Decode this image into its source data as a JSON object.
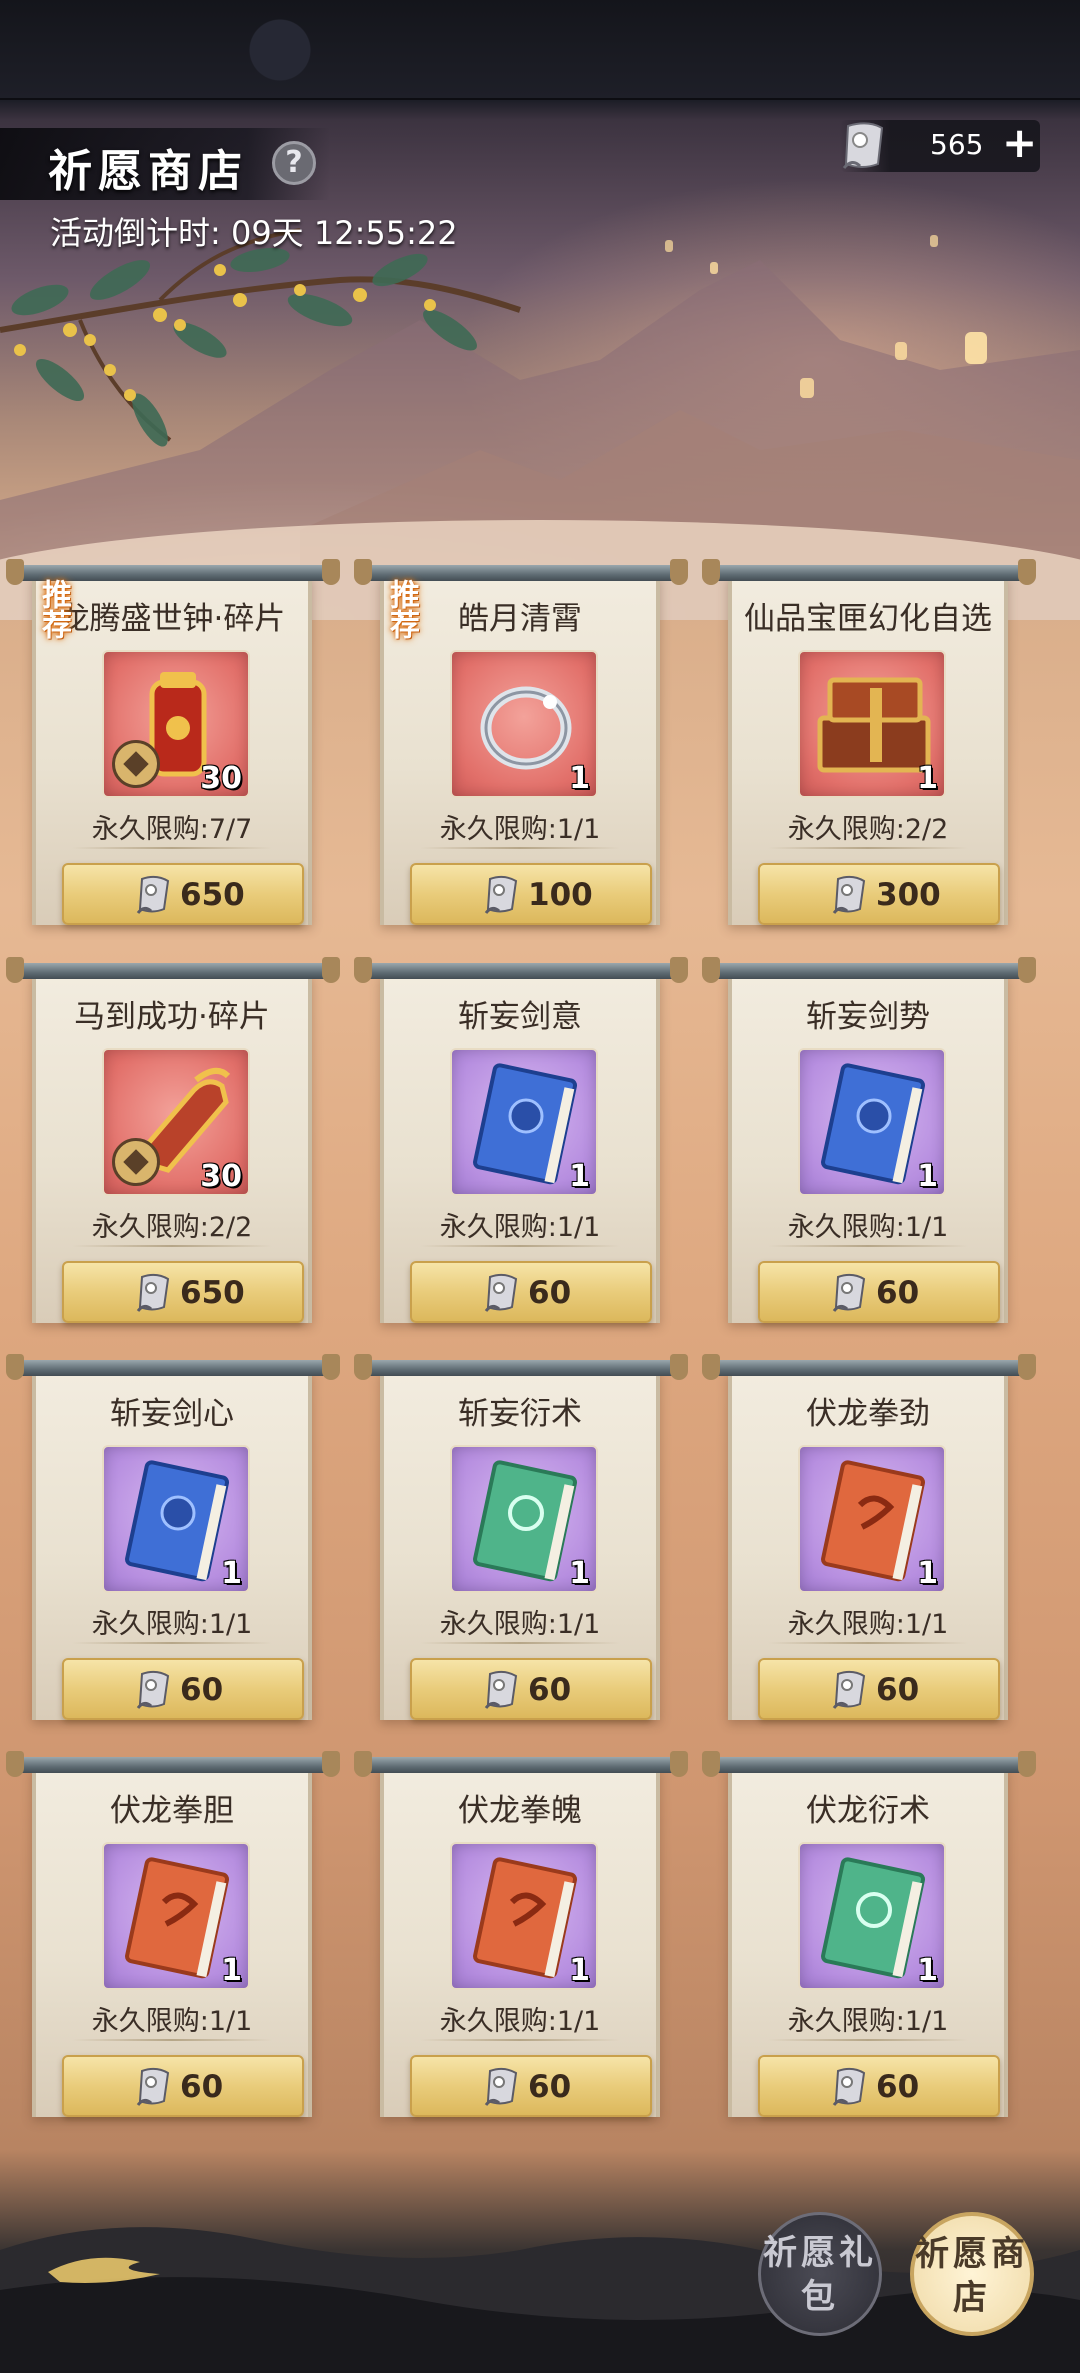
{
  "header": {
    "title": "祈愿商店",
    "help_label": "?",
    "countdown": "活动倒计时: 09天 12:55:22",
    "currency_value": "565",
    "currency_plus": "+"
  },
  "items": [
    {
      "name": "龙腾盛世钟·碎片",
      "rec": "推荐",
      "frame": "red",
      "icon": "bell-fragment-icon",
      "qty": "30",
      "fragment": true,
      "limit": "永久限购:7/7",
      "price": "650"
    },
    {
      "name": "皓月清霄",
      "rec": "推荐",
      "frame": "red",
      "icon": "silver-ring-icon",
      "qty": "1",
      "fragment": false,
      "limit": "永久限购:1/1",
      "price": "100"
    },
    {
      "name": "仙品宝匣幻化自选",
      "rec": "",
      "frame": "red",
      "icon": "treasure-box-icon",
      "qty": "1",
      "fragment": false,
      "limit": "永久限购:2/2",
      "price": "300"
    },
    {
      "name": "马到成功·碎片",
      "rec": "",
      "frame": "red",
      "icon": "horse-fragment-icon",
      "qty": "30",
      "fragment": true,
      "limit": "永久限购:2/2",
      "price": "650"
    },
    {
      "name": "斩妄剑意",
      "rec": "",
      "frame": "purple",
      "icon": "blue-book-icon",
      "qty": "1",
      "fragment": false,
      "limit": "永久限购:1/1",
      "price": "60"
    },
    {
      "name": "斩妄剑势",
      "rec": "",
      "frame": "purple",
      "icon": "blue-book-icon",
      "qty": "1",
      "fragment": false,
      "limit": "永久限购:1/1",
      "price": "60"
    },
    {
      "name": "斩妄剑心",
      "rec": "",
      "frame": "purple",
      "icon": "blue-book-icon",
      "qty": "1",
      "fragment": false,
      "limit": "永久限购:1/1",
      "price": "60"
    },
    {
      "name": "斩妄衍术",
      "rec": "",
      "frame": "purple",
      "icon": "green-book-icon",
      "qty": "1",
      "fragment": false,
      "limit": "永久限购:1/1",
      "price": "60"
    },
    {
      "name": "伏龙拳劲",
      "rec": "",
      "frame": "purple",
      "icon": "red-book-icon",
      "qty": "1",
      "fragment": false,
      "limit": "永久限购:1/1",
      "price": "60"
    },
    {
      "name": "伏龙拳胆",
      "rec": "",
      "frame": "purple",
      "icon": "red-book-icon",
      "qty": "1",
      "fragment": false,
      "limit": "永久限购:1/1",
      "price": "60"
    },
    {
      "name": "伏龙拳魄",
      "rec": "",
      "frame": "purple",
      "icon": "red-book-icon",
      "qty": "1",
      "fragment": false,
      "limit": "永久限购:1/1",
      "price": "60"
    },
    {
      "name": "伏龙衍术",
      "rec": "",
      "frame": "purple",
      "icon": "green-book-icon",
      "qty": "1",
      "fragment": false,
      "limit": "永久限购:1/1",
      "price": "60"
    }
  ],
  "tabs": {
    "gift": "祈愿礼包",
    "shop": "祈愿商店"
  },
  "colors": {
    "red_frame": "#e2706a",
    "purple_frame": "#b78fe0",
    "price_button": "#e9cc7b",
    "blue_book": "#3f6fd6",
    "green_book": "#4fb48a",
    "red_book": "#e0683e"
  }
}
